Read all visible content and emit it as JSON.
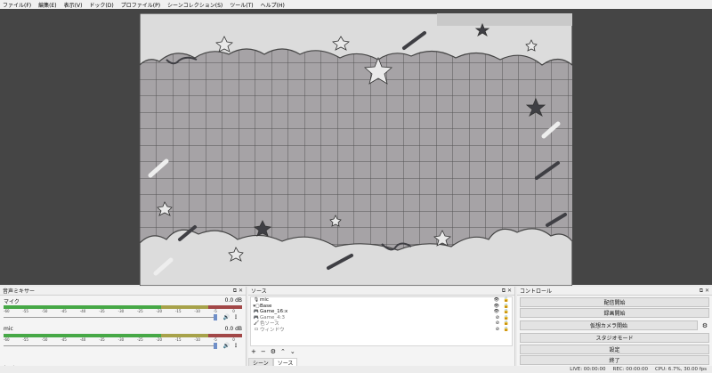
{
  "menu": [
    "ファイル(F)",
    "編集(E)",
    "表示(V)",
    "ドック(D)",
    "プロファイル(P)",
    "シーンコレクション(S)",
    "ツール(T)",
    "ヘルプ(H)"
  ],
  "mixer": {
    "title": "音声ミキサー",
    "ticks": [
      "-60",
      "-55",
      "-50",
      "-45",
      "-40",
      "-35",
      "-30",
      "-25",
      "-20",
      "-15",
      "-10",
      "-5",
      "0"
    ],
    "channels": [
      {
        "name": "マイク",
        "db": "0.0 dB",
        "level": 0.0
      },
      {
        "name": "mic",
        "db": "0.0 dB",
        "level": 0.0
      }
    ]
  },
  "sources": {
    "title": "ソース",
    "items": [
      {
        "label": "mic",
        "icon": "mic-icon",
        "glyph": "🎙",
        "dim": false
      },
      {
        "label": "Base",
        "icon": "folder-icon",
        "glyph": "▾▢",
        "dim": false
      },
      {
        "label": "Game_16:x",
        "icon": "gamepad-icon",
        "glyph": "🎮",
        "dim": false
      },
      {
        "label": "Game_4:3",
        "icon": "gamepad-icon",
        "glyph": "🎮",
        "dim": true
      },
      {
        "label": "色ソース",
        "icon": "paint-icon",
        "glyph": "🖌",
        "dim": true
      },
      {
        "label": "ウィンドウ",
        "icon": "window-icon",
        "glyph": "▭",
        "dim": true
      }
    ],
    "tabs": [
      "シーン",
      "ソース"
    ],
    "active_tab": "ソース"
  },
  "controls": {
    "title": "コントロール",
    "buttons": [
      "配信開始",
      "録画開始",
      "仮想カメラ開始",
      "スタジオモード",
      "設定",
      "終了"
    ]
  },
  "status": {
    "live": "LIVE: 00:00:00",
    "rec": "REC: 00:00:00",
    "cpu": "CPU: 6.7%, 30.00 fps"
  },
  "colors": {
    "preview_bg": "#454545",
    "canvas_bg": "#a6a3a6",
    "meter_green": "#46a846",
    "meter_yellow": "#a7a24a",
    "meter_red": "#a24747"
  }
}
